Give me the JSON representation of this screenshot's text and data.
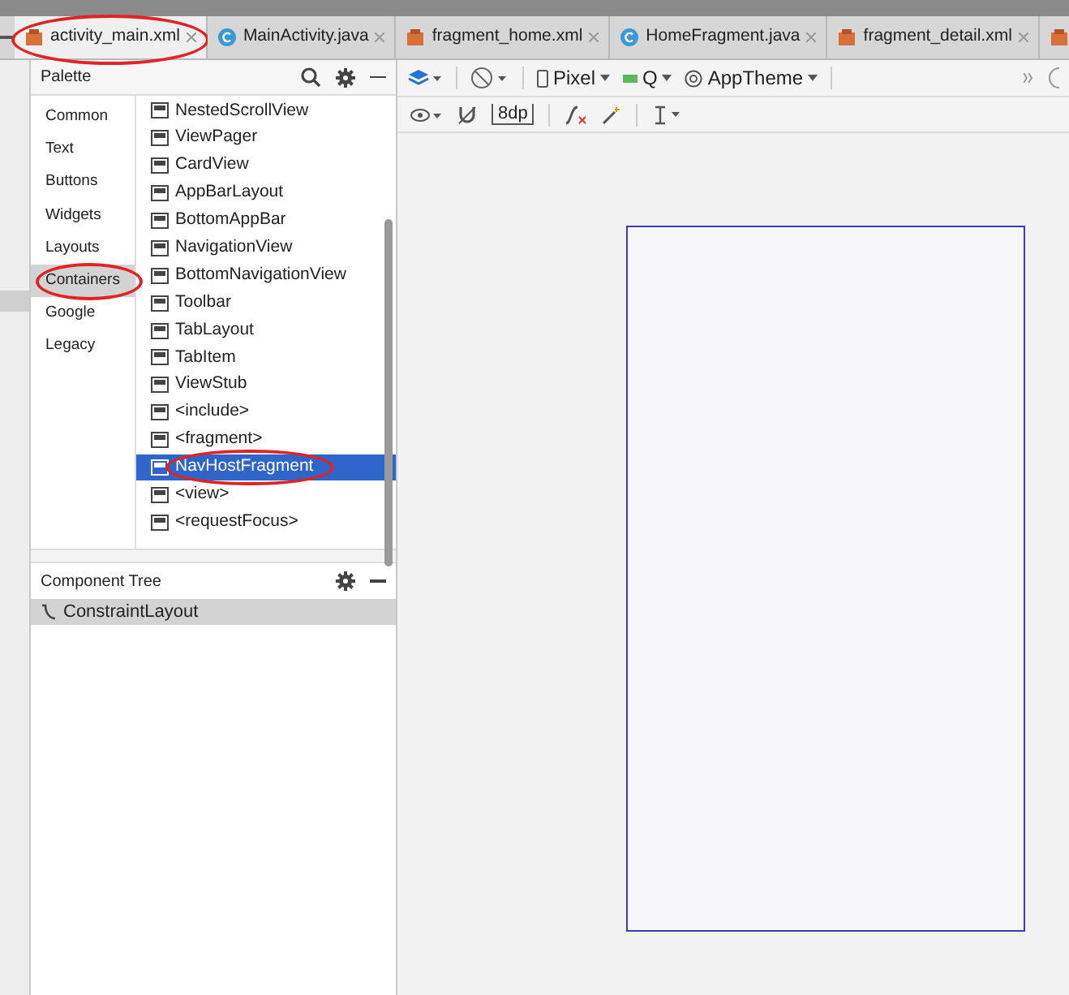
{
  "tabs": [
    {
      "label": "activity_main.xml",
      "kind": "xml",
      "selected": true,
      "circled": true
    },
    {
      "label": "MainActivity.java",
      "kind": "java",
      "selected": false,
      "circled": false
    },
    {
      "label": "fragment_home.xml",
      "kind": "xml",
      "selected": false,
      "circled": false
    },
    {
      "label": "HomeFragment.java",
      "kind": "java",
      "selected": false,
      "circled": false
    },
    {
      "label": "fragment_detail.xml",
      "kind": "xml",
      "selected": false,
      "circled": false
    },
    {
      "kind": "xml",
      "selected": false,
      "circled": false
    }
  ],
  "palette": {
    "title": "Palette",
    "categories": [
      {
        "label": "Common",
        "selected": false,
        "circled": false
      },
      {
        "label": "Text",
        "selected": false,
        "circled": false
      },
      {
        "label": "Buttons",
        "selected": false,
        "circled": false
      },
      {
        "label": "Widgets",
        "selected": false,
        "circled": false
      },
      {
        "label": "Layouts",
        "selected": false,
        "circled": false
      },
      {
        "label": "Containers",
        "selected": true,
        "circled": true
      },
      {
        "label": "Google",
        "selected": false,
        "circled": false
      },
      {
        "label": "Legacy",
        "selected": false,
        "circled": false
      }
    ],
    "items": [
      {
        "label": "NestedScrollView",
        "selected": false,
        "circled": false
      },
      {
        "label": "ViewPager",
        "selected": false,
        "circled": false
      },
      {
        "label": "CardView",
        "selected": false,
        "circled": false
      },
      {
        "label": "AppBarLayout",
        "selected": false,
        "circled": false
      },
      {
        "label": "BottomAppBar",
        "selected": false,
        "circled": false
      },
      {
        "label": "NavigationView",
        "selected": false,
        "circled": false
      },
      {
        "label": "BottomNavigationView",
        "selected": false,
        "circled": false
      },
      {
        "label": "Toolbar",
        "selected": false,
        "circled": false
      },
      {
        "label": "TabLayout",
        "selected": false,
        "circled": false
      },
      {
        "label": "TabItem",
        "selected": false,
        "circled": false
      },
      {
        "label": "ViewStub",
        "selected": false,
        "circled": false
      },
      {
        "label": "<include>",
        "selected": false,
        "circled": false
      },
      {
        "label": "<fragment>",
        "selected": false,
        "circled": false
      },
      {
        "label": "NavHostFragment",
        "selected": true,
        "circled": true
      },
      {
        "label": "<view>",
        "selected": false,
        "circled": false
      },
      {
        "label": "<requestFocus>",
        "selected": false,
        "circled": false
      }
    ]
  },
  "component_tree": {
    "title": "Component Tree",
    "nodes": [
      {
        "label": "ConstraintLayout",
        "selected": true
      }
    ]
  },
  "toolbar": {
    "device": "Pixel",
    "api": "Q",
    "theme": "AppTheme",
    "margin": "8dp"
  }
}
